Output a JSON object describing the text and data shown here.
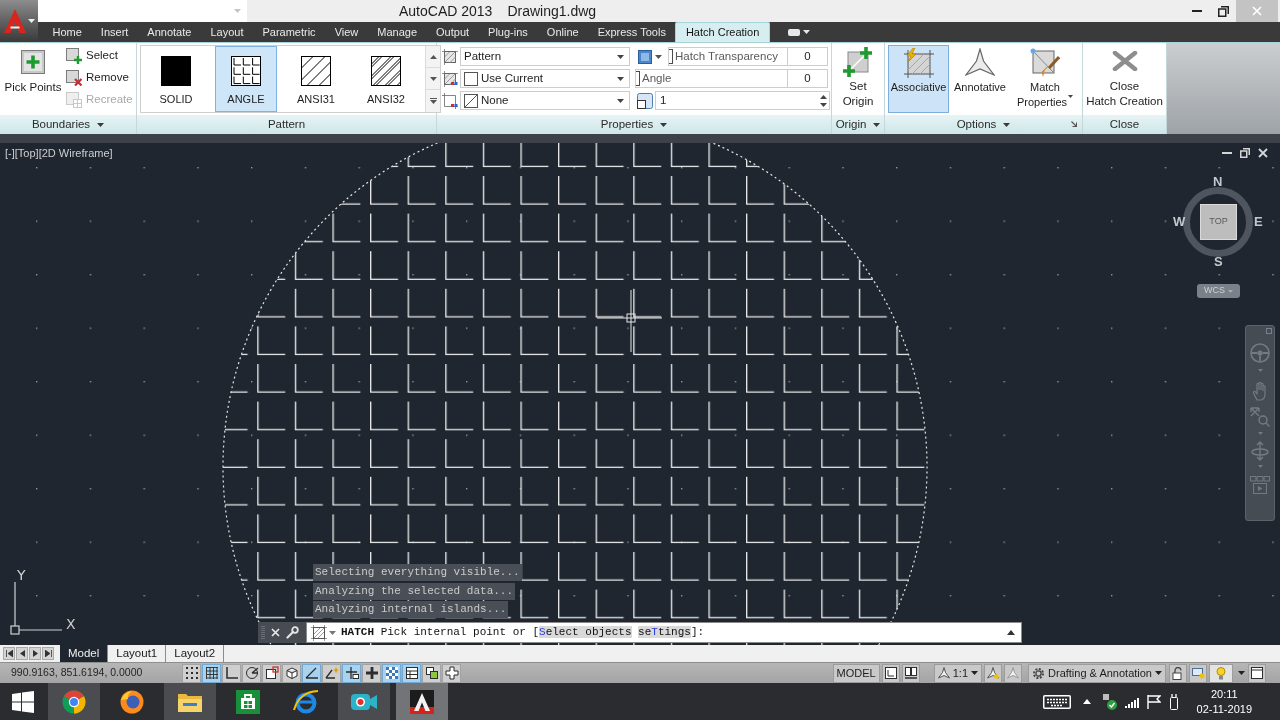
{
  "title_bar": {
    "title": "AutoCAD 2013",
    "document": "Drawing1.dwg"
  },
  "ribbon_tabs": [
    {
      "label": "Home",
      "selected": false
    },
    {
      "label": "Insert",
      "selected": false
    },
    {
      "label": "Annotate",
      "selected": false
    },
    {
      "label": "Layout",
      "selected": false
    },
    {
      "label": "Parametric",
      "selected": false
    },
    {
      "label": "View",
      "selected": false
    },
    {
      "label": "Manage",
      "selected": false
    },
    {
      "label": "Output",
      "selected": false
    },
    {
      "label": "Plug-ins",
      "selected": false
    },
    {
      "label": "Online",
      "selected": false
    },
    {
      "label": "Express Tools",
      "selected": false
    },
    {
      "label": "Hatch Creation",
      "selected": true
    }
  ],
  "boundaries_panel": {
    "title": "Boundaries",
    "pick_points": "Pick Points",
    "tools": [
      {
        "kind": "select",
        "label": "Select",
        "disabled": false
      },
      {
        "kind": "remove",
        "label": "Remove",
        "disabled": false
      },
      {
        "kind": "recreate",
        "label": "Recreate",
        "disabled": true
      }
    ]
  },
  "pattern_panel": {
    "title": "Pattern",
    "patterns": [
      {
        "kind": "solid",
        "label": "SOLID",
        "selected": false
      },
      {
        "kind": "angle",
        "label": "ANGLE",
        "selected": true
      },
      {
        "kind": "ansi31",
        "label": "ANSI31",
        "selected": false
      },
      {
        "kind": "ansi32",
        "label": "ANSI32",
        "selected": false
      }
    ]
  },
  "properties_panel": {
    "title": "Properties",
    "dropdowns": [
      {
        "kind": "type",
        "value": "Pattern"
      },
      {
        "kind": "color",
        "value": "Use Current"
      },
      {
        "kind": "background",
        "value": "None"
      }
    ],
    "sliders": [
      {
        "label": "Hatch Transparency",
        "value": "0",
        "level": 0
      },
      {
        "label": "Angle",
        "value": "0",
        "level": 0
      }
    ],
    "scale": "1"
  },
  "origin_panel": {
    "title": "Origin",
    "button": [
      "Set",
      "Origin"
    ]
  },
  "options_panel": {
    "title": "Options",
    "buttons": [
      {
        "kind": "associative",
        "label": [
          "Associative"
        ],
        "selected": true
      },
      {
        "kind": "annotative",
        "label": [
          "Annotative"
        ],
        "selected": false
      },
      {
        "kind": "match",
        "label": [
          "Match",
          "Properties"
        ],
        "selected": false
      }
    ]
  },
  "close_panel": {
    "title": "Close",
    "button": [
      "Close",
      "Hatch Creation"
    ]
  },
  "viewport": {
    "controls": [
      "[-]",
      "[Top]",
      "[2D Wireframe]"
    ],
    "viewcube": {
      "north": "N",
      "west": "W",
      "face": "TOP",
      "east": "E",
      "south": "S",
      "ucs_menu": "WCS"
    },
    "ucs_icon": {
      "y": "Y",
      "x": "X"
    }
  },
  "progress_messages": [
    "Selecting everything visible...",
    "Analyzing the selected data...",
    "Analyzing internal islands..."
  ],
  "command_line": {
    "command": "HATCH",
    "prompt": "Pick internal point or [",
    "options": [
      {
        "key": "S",
        "after": "elect objects"
      },
      {
        "before": "se",
        "key": "T",
        "after": "tings"
      }
    ],
    "close": "]:"
  },
  "layout_tabs": [
    {
      "label": "Model",
      "selected": true
    },
    {
      "label": "Layout1",
      "selected": false
    },
    {
      "label": "Layout2",
      "selected": false
    }
  ],
  "status_bar": {
    "coordinates": "990.9163, 851.6194, 0.0000",
    "toggles": [
      {
        "kind": "snap",
        "on": false
      },
      {
        "kind": "grid",
        "on": true
      },
      {
        "kind": "ortho",
        "on": false
      },
      {
        "kind": "polar",
        "on": false
      },
      {
        "kind": "osnap",
        "on": false
      },
      {
        "kind": "cubesnap",
        "on": false
      },
      {
        "kind": "otrack",
        "on": true
      },
      {
        "kind": "ducs",
        "on": false
      },
      {
        "kind": "dyn",
        "on": true
      },
      {
        "kind": "lwt",
        "on": false
      },
      {
        "kind": "tpy",
        "on": true
      },
      {
        "kind": "qp",
        "on": true
      },
      {
        "kind": "sc",
        "on": false
      },
      {
        "kind": "am",
        "on": false
      }
    ],
    "space": "MODEL",
    "annotation_scale": "1:1",
    "workspace": "Drafting & Annotation"
  },
  "taskbar": {
    "apps": [
      {
        "kind": "chrome",
        "running": true,
        "selected": false
      },
      {
        "kind": "firefox",
        "running": false,
        "selected": false
      },
      {
        "kind": "explorer",
        "running": true,
        "selected": false
      },
      {
        "kind": "store",
        "running": false,
        "selected": false
      },
      {
        "kind": "ie",
        "running": false,
        "selected": false
      },
      {
        "kind": "recorder",
        "running": true,
        "selected": false
      },
      {
        "kind": "autocad",
        "running": true,
        "selected": true
      }
    ],
    "time": "20:11",
    "date": "02-11-2019"
  }
}
